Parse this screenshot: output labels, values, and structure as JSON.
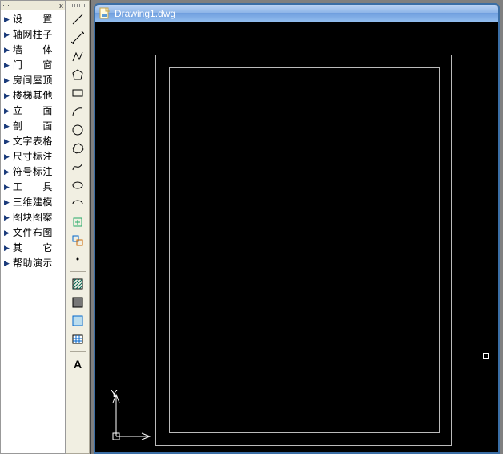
{
  "sidePanel": {
    "close": "x",
    "grip": "⋯",
    "items": [
      {
        "label": "设　　置"
      },
      {
        "label": "轴网柱子"
      },
      {
        "label": "墙　　体"
      },
      {
        "label": "门　　窗"
      },
      {
        "label": "房间屋顶"
      },
      {
        "label": "楼梯其他"
      },
      {
        "label": "立　　面"
      },
      {
        "label": "剖　　面"
      },
      {
        "label": "文字表格"
      },
      {
        "label": "尺寸标注"
      },
      {
        "label": "符号标注"
      },
      {
        "label": "工　　具"
      },
      {
        "label": "三维建模"
      },
      {
        "label": "图块图案"
      },
      {
        "label": "文件布图"
      },
      {
        "label": "其　　它"
      },
      {
        "label": "帮助演示"
      }
    ]
  },
  "tools": {
    "textLabel": "A"
  },
  "window": {
    "title": "Drawing1.dwg"
  },
  "ucs": {
    "y": "Y"
  }
}
